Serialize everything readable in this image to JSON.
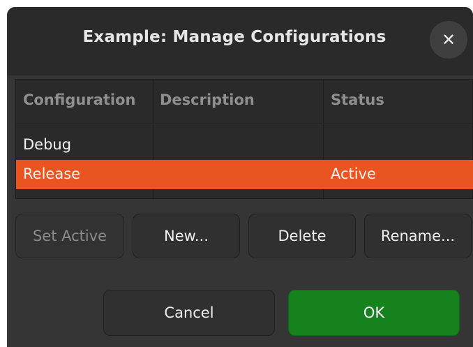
{
  "dialog": {
    "title": "Example: Manage Configurations",
    "close_icon": "close-icon"
  },
  "table": {
    "columns": [
      "Configuration",
      "Description",
      "Status"
    ],
    "rows": [
      {
        "configuration": "Debug",
        "description": "",
        "status": ""
      },
      {
        "configuration": "Release",
        "description": "",
        "status": "Active",
        "selected": true
      }
    ],
    "selection_color": "#e95420"
  },
  "buttons": {
    "set_active": "Set Active",
    "new": "New...",
    "delete": "Delete",
    "rename": "Rename...",
    "cancel": "Cancel",
    "ok": "OK"
  },
  "colors": {
    "ok": "#16821e"
  }
}
